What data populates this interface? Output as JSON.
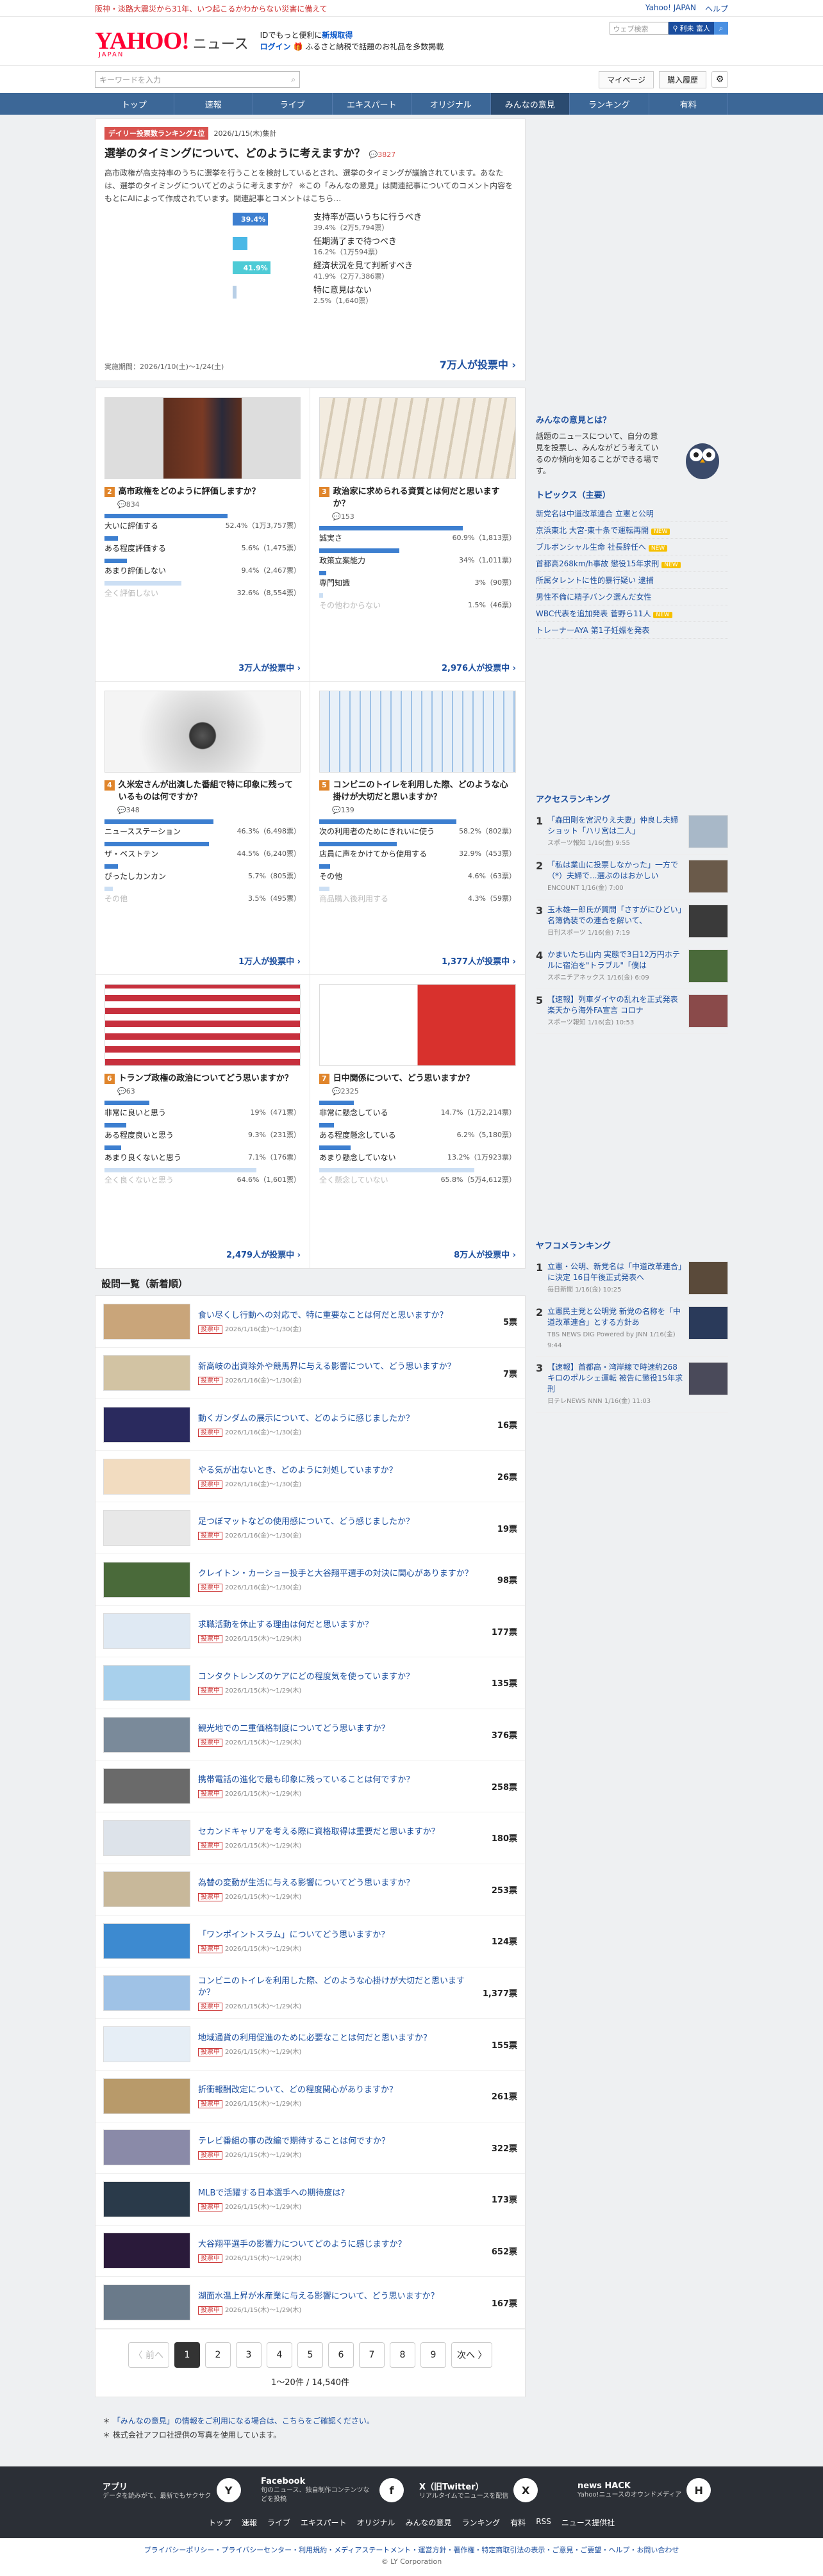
{
  "topbar": {
    "alert": "阪神・淡路大震災から31年、いつ起こるかわからない災害に備えて",
    "links": [
      "Yahoo! JAPAN",
      "ヘルプ"
    ]
  },
  "header": {
    "logo": "YAHOO!",
    "logo_sub": "JAPAN",
    "news": "ニュース",
    "login_line1": "IDでもっと便利に",
    "login_new": "新規取得",
    "login": "ログイン",
    "login_promo": "ふるさと納税で話題のお礼品を多数掲載",
    "search_placeholder": "ウェブ検索",
    "search_btn": "利未 富人"
  },
  "searchrow": {
    "placeholder": "キーワードを入力",
    "mypage": "マイページ",
    "history": "購入履歴"
  },
  "nav": [
    "トップ",
    "速報",
    "ライブ",
    "エキスパート",
    "オリジナル",
    "みんなの意見",
    "ランキング",
    "有料"
  ],
  "nav_active": 5,
  "featured": {
    "badge": "デイリー投票数ランキング1位",
    "date": "2026/1/15(木)集計",
    "title": "選挙のタイミングについて、どのように考えますか？",
    "count": "3827",
    "text": "高市政権が高支持率のうちに選挙を行うことを検討しているとされ、選挙のタイミングが議論されています。あなたは、選挙のタイミングについてどのように考えますか？ ※この「みんなの意見」は関連記事についてのコメント内容をもとにAIによって作成されています。関連記事とコメントはこちら…",
    "options": [
      {
        "label": "支持率が高いうちに行うべき",
        "detail": "39.4%（2万5,794票）",
        "pct": 39.4,
        "color": "#3d7fd0",
        "showpct": "39.4%"
      },
      {
        "label": "任期満了まで待つべき",
        "detail": "16.2%（1万594票）",
        "pct": 16.2,
        "color": "#4ab8e6",
        "showpct": ""
      },
      {
        "label": "経済状況を見て判断すべき",
        "detail": "41.9%（2万7,386票）",
        "pct": 41.9,
        "color": "#4ecbd6",
        "showpct": "41.9%"
      },
      {
        "label": "特に意見はない",
        "detail": "2.5%（1,640票）",
        "pct": 2.5,
        "color": "#b8cfe6",
        "showpct": ""
      }
    ],
    "period": "実施期間：2026/1/10(土)〜1/24(土)",
    "vote": "7万人が投票中"
  },
  "polls": [
    {
      "n": "2",
      "title": "高市政権をどのように評価しますか？",
      "meta": "834",
      "img": "img-a",
      "opts": [
        {
          "l": "大いに評価する",
          "v": "52.4%（1万3,757票）",
          "p": 52.4
        },
        {
          "l": "ある程度評価する",
          "v": "5.6%（1,475票）",
          "p": 5.6
        },
        {
          "l": "あまり評価しない",
          "v": "9.4%（2,467票）",
          "p": 9.4
        },
        {
          "l": "全く評価しない",
          "v": "32.6%（8,554票）",
          "p": 32.6
        }
      ],
      "vote": "3万人が投票中"
    },
    {
      "n": "3",
      "title": "政治家に求められる資質とは何だと思いますか？",
      "meta": "153",
      "img": "img-b",
      "opts": [
        {
          "l": "誠実さ",
          "v": "60.9%（1,813票）",
          "p": 60.9
        },
        {
          "l": "政策立案能力",
          "v": "34%（1,011票）",
          "p": 34
        },
        {
          "l": "専門知識",
          "v": "3%（90票）",
          "p": 3
        },
        {
          "l": "その他わからない",
          "v": "1.5%（46票）",
          "p": 1.5
        }
      ],
      "vote": "2,976人が投票中"
    },
    {
      "n": "4",
      "title": "久米宏さんが出演した番組で特に印象に残っているものは何ですか？",
      "meta": "348",
      "img": "img-c",
      "opts": [
        {
          "l": "ニュースステーション",
          "v": "46.3%（6,498票）",
          "p": 46.3
        },
        {
          "l": "ザ・ベストテン",
          "v": "44.5%（6,240票）",
          "p": 44.5
        },
        {
          "l": "ぴったしカンカン",
          "v": "5.7%（805票）",
          "p": 5.7
        },
        {
          "l": "その他",
          "v": "3.5%（495票）",
          "p": 3.5
        }
      ],
      "vote": "1万人が投票中"
    },
    {
      "n": "5",
      "title": "コンビニのトイレを利用した際、どのような心掛けが大切だと思いますか？",
      "meta": "139",
      "img": "img-d",
      "opts": [
        {
          "l": "次の利用者のためにきれいに使う",
          "v": "58.2%（802票）",
          "p": 58.2
        },
        {
          "l": "店員に声をかけてから使用する",
          "v": "32.9%（453票）",
          "p": 32.9
        },
        {
          "l": "その他",
          "v": "4.6%（63票）",
          "p": 4.6
        },
        {
          "l": "商品購入後利用する",
          "v": "4.3%（59票）",
          "p": 4.3
        }
      ],
      "vote": "1,377人が投票中"
    },
    {
      "n": "6",
      "title": "トランプ政権の政治についてどう思いますか？",
      "meta": "63",
      "img": "img-e",
      "opts": [
        {
          "l": "非常に良いと思う",
          "v": "19%（471票）",
          "p": 19
        },
        {
          "l": "ある程度良いと思う",
          "v": "9.3%（231票）",
          "p": 9.3
        },
        {
          "l": "あまり良くないと思う",
          "v": "7.1%（176票）",
          "p": 7.1
        },
        {
          "l": "全く良くないと思う",
          "v": "64.6%（1,601票）",
          "p": 64.6
        }
      ],
      "vote": "2,479人が投票中"
    },
    {
      "n": "7",
      "title": "日中関係について、どう思いますか？",
      "meta": "2325",
      "img": "img-f",
      "opts": [
        {
          "l": "非常に懸念している",
          "v": "14.7%（1万2,214票）",
          "p": 14.7
        },
        {
          "l": "ある程度懸念している",
          "v": "6.2%（5,180票）",
          "p": 6.2
        },
        {
          "l": "あまり懸念していない",
          "v": "13.2%（1万923票）",
          "p": 13.2
        },
        {
          "l": "全く懸念していない",
          "v": "65.8%（5万4,612票）",
          "p": 65.8
        }
      ],
      "vote": "8万人が投票中"
    }
  ],
  "list_title": "設問一覧（新着順）",
  "list": [
    {
      "t": "食い尽くし行動への対応で、特に重要なことは何だと思いますか？",
      "m": "2026/1/16(金)〜1/30(金)",
      "c": "5票",
      "bg": "#c9a57a"
    },
    {
      "t": "新高岐の出資除外や競馬界に与える影響について、どう思いますか？",
      "m": "2026/1/16(金)〜1/30(金)",
      "c": "7票",
      "bg": "#d2c3a3"
    },
    {
      "t": "動くガンダムの展示について、どのように感じましたか？",
      "m": "2026/1/16(金)〜1/30(金)",
      "c": "16票",
      "bg": "#2a2a5e"
    },
    {
      "t": "やる気が出ないとき、どのように対処していますか？",
      "m": "2026/1/16(金)〜1/30(金)",
      "c": "26票",
      "bg": "#f2dcc0"
    },
    {
      "t": "足つぼマットなどの使用感について、どう感じましたか？",
      "m": "2026/1/16(金)〜1/30(金)",
      "c": "19票",
      "bg": "#e8e8e8"
    },
    {
      "t": "クレイトン・カーショー投手と大谷翔平選手の対決に関心がありますか？",
      "m": "2026/1/16(金)〜1/30(金)",
      "c": "98票",
      "bg": "#4a6a3a"
    },
    {
      "t": "求職活動を休止する理由は何だと思いますか？",
      "m": "2026/1/15(木)〜1/29(木)",
      "c": "177票",
      "bg": "#dfe9f3"
    },
    {
      "t": "コンタクトレンズのケアにどの程度気を使っていますか？",
      "m": "2026/1/15(木)〜1/29(木)",
      "c": "135票",
      "bg": "#a8d0ec"
    },
    {
      "t": "観光地での二重価格制度についてどう思いますか？",
      "m": "2026/1/15(木)〜1/29(木)",
      "c": "376票",
      "bg": "#7a8a9a"
    },
    {
      "t": "携帯電話の進化で最も印象に残っていることは何ですか？",
      "m": "2026/1/15(木)〜1/29(木)",
      "c": "258票",
      "bg": "#6a6a6a"
    },
    {
      "t": "セカンドキャリアを考える際に資格取得は重要だと思いますか？",
      "m": "2026/1/15(木)〜1/29(木)",
      "c": "180票",
      "bg": "#dde3ea"
    },
    {
      "t": "為替の変動が生活に与える影響についてどう思いますか？",
      "m": "2026/1/15(木)〜1/29(木)",
      "c": "253票",
      "bg": "#c8b89a"
    },
    {
      "t": "「ワンポイントスラム」についてどう思いますか？",
      "m": "2026/1/15(木)〜1/29(木)",
      "c": "124票",
      "bg": "#3d8ad0"
    },
    {
      "t": "コンビニのトイレを利用した際、どのような心掛けが大切だと思いますか？",
      "m": "2026/1/15(木)〜1/29(木)",
      "c": "1,377票",
      "bg": "#9fc2e6"
    },
    {
      "t": "地域通貨の利用促進のために必要なことは何だと思いますか？",
      "m": "2026/1/15(木)〜1/29(木)",
      "c": "155票",
      "bg": "#e6eef6"
    },
    {
      "t": "折衝報酬改定について、どの程度関心がありますか？",
      "m": "2026/1/15(木)〜1/29(木)",
      "c": "261票",
      "bg": "#b89a6a"
    },
    {
      "t": "テレビ番組の事の改編で期待することは何ですか？",
      "m": "2026/1/15(木)〜1/29(木)",
      "c": "322票",
      "bg": "#8a8aa8"
    },
    {
      "t": "MLBで活躍する日本選手への期待度は？",
      "m": "2026/1/15(木)〜1/29(木)",
      "c": "173票",
      "bg": "#2a3a4a"
    },
    {
      "t": "大谷翔平選手の影響力についてどのように感じますか？",
      "m": "2026/1/15(木)〜1/29(木)",
      "c": "652票",
      "bg": "#2a1a3a"
    },
    {
      "t": "湖面水温上昇が水産業に与える影響について、どう思いますか？",
      "m": "2026/1/15(木)〜1/29(木)",
      "c": "167票",
      "bg": "#6a7a8a"
    }
  ],
  "tag_label": "投票中",
  "pager": {
    "prev": "〈 前へ",
    "next": "次へ 〉",
    "pages": [
      "1",
      "2",
      "3",
      "4",
      "5",
      "6",
      "7",
      "8",
      "9"
    ],
    "count": "1〜20件 / 14,540件"
  },
  "notes": [
    "「みんなの意見」の情報をご利用になる場合は、こちらをご確認ください。",
    "株式会社アフロ社提供の写真を使用しています。"
  ],
  "side": {
    "iken_title": "みんなの意見とは？",
    "iken_text": "話題のニュースについて、自分の意見を投票し、みんながどう考えているのか傾向を知ることができる場です。",
    "topics_title": "トピックス（主要）",
    "topics": [
      {
        "t": "新党名は中道改革連合 立憲と公明",
        "new": false
      },
      {
        "t": "京浜東北 大宮-東十条で運転再開",
        "new": true
      },
      {
        "t": "ブルボンシャル生命 社長辞任へ",
        "new": true
      },
      {
        "t": "首都高268km/h事故 懲役15年求刑",
        "new": true
      },
      {
        "t": "所属タレントに性的暴行疑い 逮捕",
        "new": false
      },
      {
        "t": "男性不倫に精子バンク選んだ女性",
        "new": false
      },
      {
        "t": "WBC代表を追加発表 菅野ら11人",
        "new": true
      },
      {
        "t": "トレーナーAYA 第1子妊娠を発表",
        "new": false
      }
    ],
    "new_label": "NEW",
    "access_title": "アクセスランキング",
    "access": [
      {
        "t": "「森田剛を宮沢りえ夫妻」仲良し夫婦ショット「ハリ宮は二人」",
        "s": "スポーツ報知 1/16(金) 9:55"
      },
      {
        "t": "「私は業山に投票しなかった」一方で（*）夫婦で...選ぶのはおかしい",
        "s": "ENCOUNT 1/16(金) 7:00"
      },
      {
        "t": "玉木雄一郎氏が質問「さすがにひどい」名簿偽装での連合を解いて、",
        "s": "日刊スポーツ 1/16(金) 7:19"
      },
      {
        "t": "かまいたち山内 実態で3日12万円ホテルに宿泊を\"トラブル\"「僕は",
        "s": "スポニチアネックス 1/16(金) 6:09"
      },
      {
        "t": "【速報】列車ダイヤの乱れを正式発表 楽天から海外FA宣言 コロナ",
        "s": "スポーツ報知 1/16(金) 10:53"
      }
    ],
    "yafoo_title": "ヤフコメランキング",
    "yafoo": [
      {
        "t": "立憲・公明、新党名は「中道改革連合」に決定 16日午後正式発表へ",
        "s": "毎日新聞 1/16(金) 10:25"
      },
      {
        "t": "立憲民主党と公明党 新党の名称を「中道改革連合」とする方針あ",
        "s": "TBS NEWS DIG Powered by JNN 1/16(金) 9:44"
      },
      {
        "t": "【速報】首都高・湾岸線で時速約268キロのポルシェ運転 被告に懲役15年求刑",
        "s": "日テレNEWS NNN 1/16(金) 11:03"
      }
    ]
  },
  "footer": {
    "items": [
      {
        "t": "アプリ",
        "d": "データを読みがて、最新でもサクサク",
        "ic": "Y"
      },
      {
        "t": "Facebook",
        "d": "旬のニュース、独自制作コンテンツなどを投稿",
        "ic": "f"
      },
      {
        "t": "X（旧Twitter）",
        "d": "リアルタイムでニュースを配信",
        "ic": "X"
      },
      {
        "t": "news HACK",
        "d": "Yahoo!ニュースのオウンドメディア",
        "ic": "H"
      }
    ],
    "nav": [
      "トップ",
      "速報",
      "ライブ",
      "エキスパート",
      "オリジナル",
      "みんなの意見",
      "ランキング",
      "有料",
      "RSS",
      "ニュース提供社"
    ],
    "legal": "プライバシーポリシー・プライバシーセンター・利用規約・メディアステートメント・運営方針・著作権・特定商取引法の表示・ご意見・ご要望・ヘルプ・お問い合わせ",
    "copy": "© LY Corporation"
  }
}
